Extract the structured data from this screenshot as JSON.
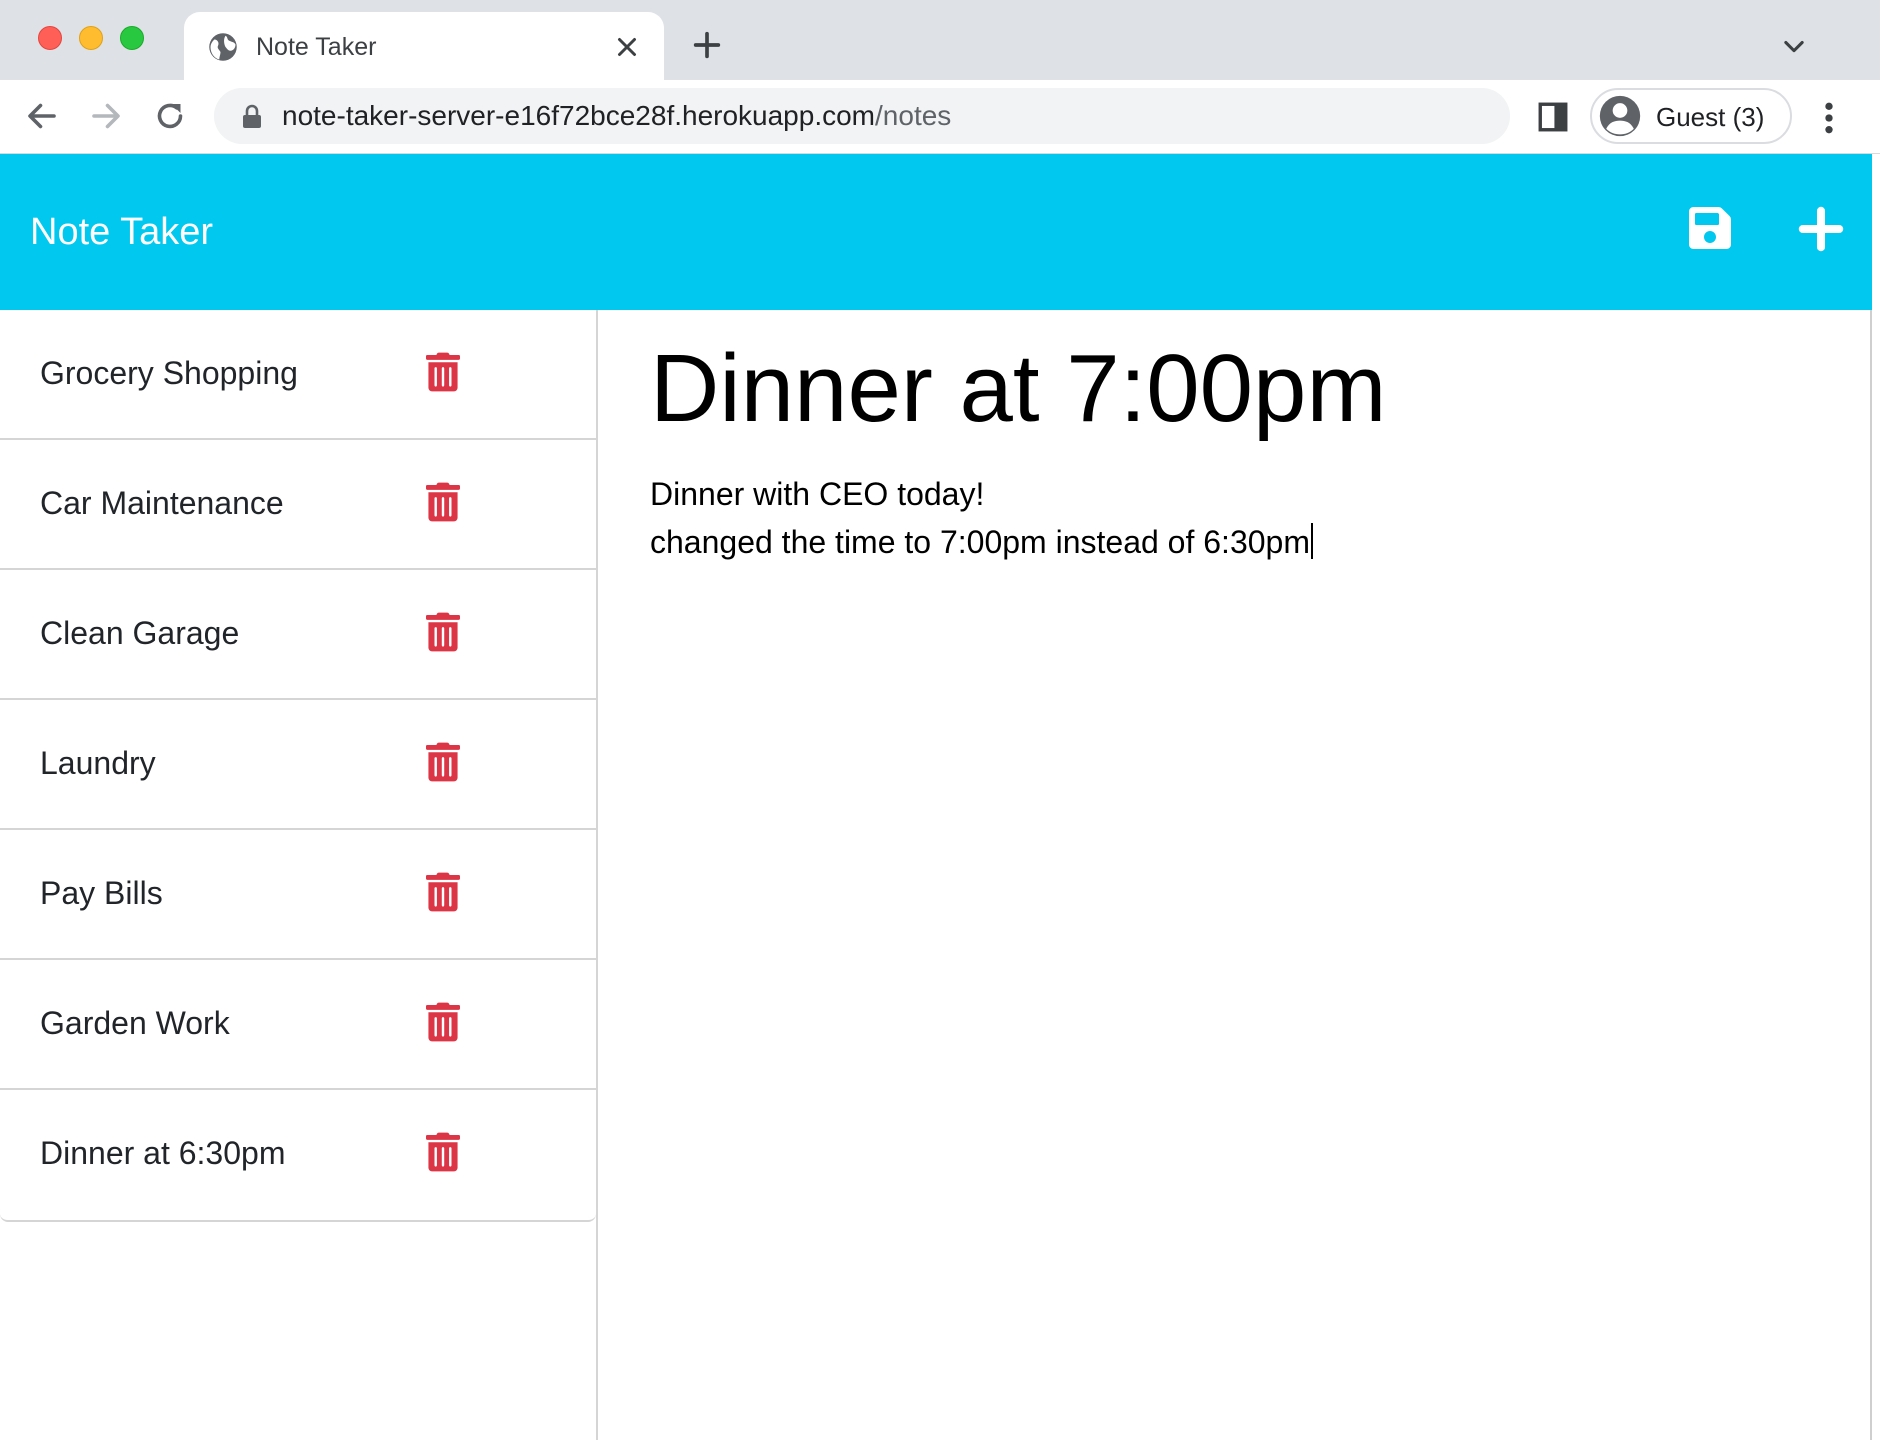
{
  "browser": {
    "tab_title": "Note Taker",
    "url_host": "note-taker-server-e16f72bce28f.herokuapp.com",
    "url_path": "/notes",
    "profile_label": "Guest (3)"
  },
  "app": {
    "brand": "Note Taker",
    "accent_color": "#00c8ef",
    "delete_color": "#dc3545",
    "notes": [
      {
        "title": "Grocery Shopping"
      },
      {
        "title": "Car Maintenance"
      },
      {
        "title": "Clean Garage"
      },
      {
        "title": "Laundry"
      },
      {
        "title": "Pay Bills"
      },
      {
        "title": "Garden Work"
      },
      {
        "title": "Dinner at 6:30pm"
      }
    ],
    "active_note": {
      "title": "Dinner at 7:00pm",
      "text_lines": [
        "Dinner with CEO today!",
        "changed the time to 7:00pm instead of 6:30pm"
      ]
    }
  }
}
